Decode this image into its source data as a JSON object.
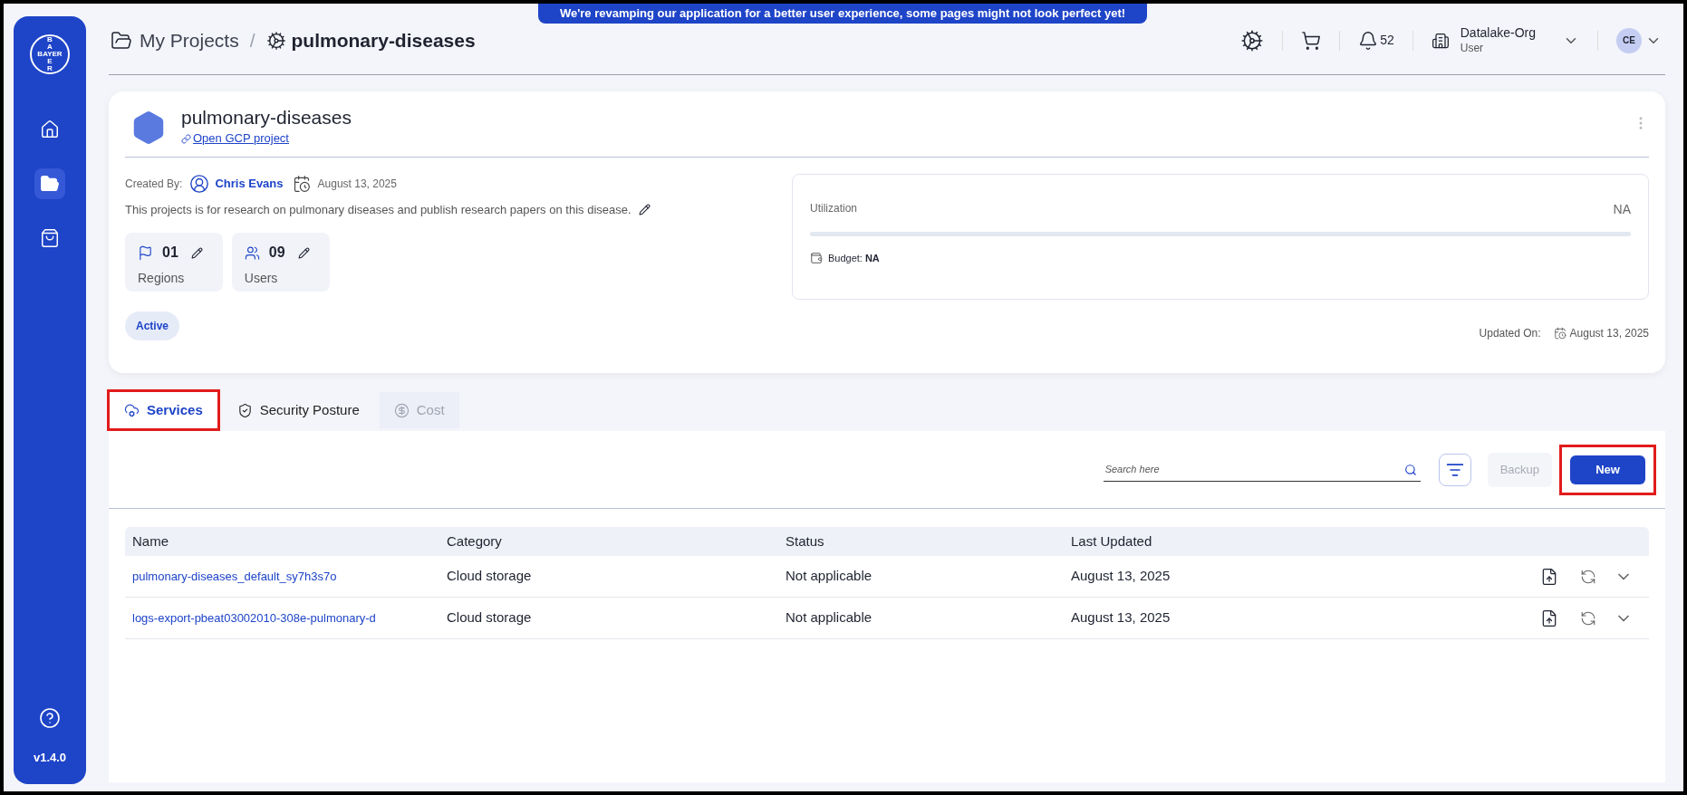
{
  "banner": "We're revamping our application for a better user experience, some pages might not look perfect yet!",
  "sidebar": {
    "logo": {
      "top": "BA",
      "middle": "BAYER",
      "bottom": "ER"
    },
    "items": [
      {
        "kind": "home",
        "selected": false
      },
      {
        "kind": "projects",
        "selected": true
      },
      {
        "kind": "store",
        "selected": false
      }
    ],
    "version": "v1.4.0"
  },
  "breadcrumb": {
    "parent": "My Projects",
    "separator": "/",
    "current": "pulmonary-diseases"
  },
  "header": {
    "notifications": "52",
    "org": "Datalake-Org",
    "role": "User",
    "avatar": "CE"
  },
  "project": {
    "title": "pulmonary-diseases",
    "link": "Open GCP project",
    "created_by_label": "Created By:",
    "creator": "Chris Evans",
    "created_date": "August 13, 2025",
    "description": "This projects is for research on pulmonary diseases and publish research papers on this disease.",
    "stats": [
      {
        "kind": "regions",
        "value": "01",
        "label": "Regions"
      },
      {
        "kind": "users",
        "value": "09",
        "label": "Users"
      }
    ],
    "status": "Active",
    "utilization": {
      "label": "Utilization",
      "value": "NA"
    },
    "budget_label": "Budget:",
    "budget_value": "NA",
    "updated_label": "Updated On:",
    "updated_date": "August 13, 2025"
  },
  "tabs": [
    {
      "kind": "services",
      "label": "Services",
      "selected": true,
      "disabled": false,
      "highlighted": true
    },
    {
      "kind": "security",
      "label": "Security Posture",
      "selected": false,
      "disabled": false,
      "highlighted": false
    },
    {
      "kind": "cost",
      "label": "Cost",
      "selected": false,
      "disabled": true,
      "highlighted": false
    }
  ],
  "toolbar": {
    "search": {
      "placeholder": "Search here"
    },
    "backup": {
      "label": "Backup",
      "disabled": true
    },
    "new": {
      "label": "New",
      "highlighted": true
    }
  },
  "table": {
    "columns": [
      "Name",
      "Category",
      "Status",
      "Last Updated"
    ],
    "rows": [
      [
        "pulmonary-diseases_default_sy7h3s7o",
        "Cloud storage",
        "Not applicable",
        "August 13, 2025"
      ],
      [
        "logs-export-pbeat03002010-308e-pulmonary-d",
        "Cloud storage",
        "Not applicable",
        "August 13, 2025"
      ]
    ]
  }
}
